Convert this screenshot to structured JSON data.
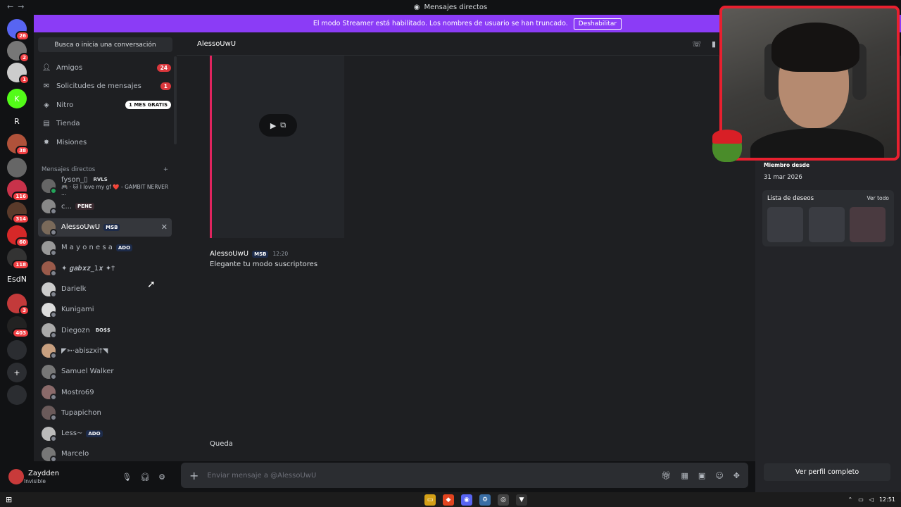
{
  "window": {
    "title": "Mensajes directos"
  },
  "banner": {
    "text": "El modo Streamer está habilitado. Los nombres de usuario se han truncado.",
    "button": "Deshabilitar"
  },
  "rail": {
    "servers": [
      {
        "label": "",
        "badge": "26",
        "color": "#5865f2"
      },
      {
        "label": "",
        "badge": "2",
        "color": "#777777"
      },
      {
        "label": "",
        "badge": "1",
        "color": "#cccccc"
      },
      {
        "label": "K",
        "badge": "",
        "color": "#53fc18"
      },
      {
        "label": "R",
        "badge": "",
        "color": "#111214"
      },
      {
        "label": "",
        "badge": "38",
        "color": "#b0523a"
      },
      {
        "label": "",
        "badge": "",
        "color": "#666666"
      },
      {
        "label": "",
        "badge": "116",
        "color": "#c8324a"
      },
      {
        "label": "",
        "badge": "314",
        "color": "#5a3a2a"
      },
      {
        "label": "",
        "badge": "60",
        "color": "#d62828"
      },
      {
        "label": "",
        "badge": "118",
        "color": "#333333"
      },
      {
        "label": "EsdN",
        "badge": "",
        "color": "#111214"
      },
      {
        "label": "",
        "badge": "3",
        "color": "#c33a3a"
      },
      {
        "label": "",
        "badge": "403",
        "color": "#222222"
      },
      {
        "label": "",
        "badge": "",
        "color": "#2b2d31"
      },
      {
        "label": "+",
        "badge": "",
        "color": "#2b2d31"
      },
      {
        "label": "",
        "badge": "",
        "color": "#2b2d31"
      }
    ]
  },
  "sidebar": {
    "search": "Busca o inicia una conversación",
    "nav": [
      {
        "label": "Amigos",
        "count": "24",
        "pill": ""
      },
      {
        "label": "Solicitudes de mensajes",
        "count": "1",
        "pill": ""
      },
      {
        "label": "Nitro",
        "count": "",
        "pill": "1 MES GRATIS"
      },
      {
        "label": "Tienda",
        "count": "",
        "pill": ""
      },
      {
        "label": "Misiones",
        "count": "",
        "pill": ""
      }
    ],
    "dm_header": "Mensajes directos",
    "dms": [
      {
        "name": "fyson_▯",
        "tag": "RVLS",
        "sub": "🎮 · 🐱 I love my gf ❤️ - GAMBIT NERVER ...",
        "online": true,
        "color": "#666666"
      },
      {
        "name": "c...",
        "tag": "PENE",
        "sub": "",
        "online": false,
        "color": "#888888"
      },
      {
        "name": "AlessoUwU",
        "tag": "MSB",
        "sub": "",
        "online": false,
        "color": "#7a6a5a"
      },
      {
        "name": "M a y o n e s a",
        "tag": "ADO",
        "sub": "",
        "online": false,
        "color": "#999999"
      },
      {
        "name": "✦ 𝒈𝒂𝒃𝒙𝒛_1𝒙 ✦†",
        "tag": "",
        "sub": "",
        "online": false,
        "color": "#9a5a4a"
      },
      {
        "name": "Darielk",
        "tag": "",
        "sub": "",
        "online": false,
        "color": "#cccccc"
      },
      {
        "name": "Kunigami",
        "tag": "",
        "sub": "",
        "online": false,
        "color": "#dddddd"
      },
      {
        "name": "Diegozn",
        "tag": "BO$$",
        "sub": "",
        "online": false,
        "color": "#aaaaaa"
      },
      {
        "name": "◤➳·abiszxi†◥",
        "tag": "",
        "sub": "",
        "online": false,
        "color": "#c8a080"
      },
      {
        "name": "Samuel Walker",
        "tag": "",
        "sub": "",
        "online": false,
        "color": "#777777"
      },
      {
        "name": "Mostro69",
        "tag": "",
        "sub": "",
        "online": false,
        "color": "#8a6a6a"
      },
      {
        "name": "Tupapichon",
        "tag": "",
        "sub": "",
        "online": false,
        "color": "#6a5a5a"
      },
      {
        "name": "Less~",
        "tag": "ADO",
        "sub": "",
        "online": false,
        "color": "#bbbbbb"
      },
      {
        "name": "Marcelo",
        "tag": "",
        "sub": "",
        "online": false,
        "color": "#777777"
      }
    ]
  },
  "user": {
    "name": "Zaydden",
    "status": "Invisible"
  },
  "chat": {
    "recipient": "AlessoUwU",
    "message": {
      "author": "AlessoUwU",
      "tag": "MSB",
      "time": "12:20",
      "text": "Elegante tu modo suscriptores"
    },
    "message2": "Queda",
    "composer_placeholder": "Enviar mensaje a @AlessoUwU"
  },
  "profile": {
    "member_since_label": "Miembro desde",
    "member_since": "31 mar 2026",
    "wishlist_title": "Lista de deseos",
    "wishlist_link": "Ver todo",
    "full_profile": "Ver perfil completo"
  },
  "taskbar": {
    "time": "12:51"
  }
}
